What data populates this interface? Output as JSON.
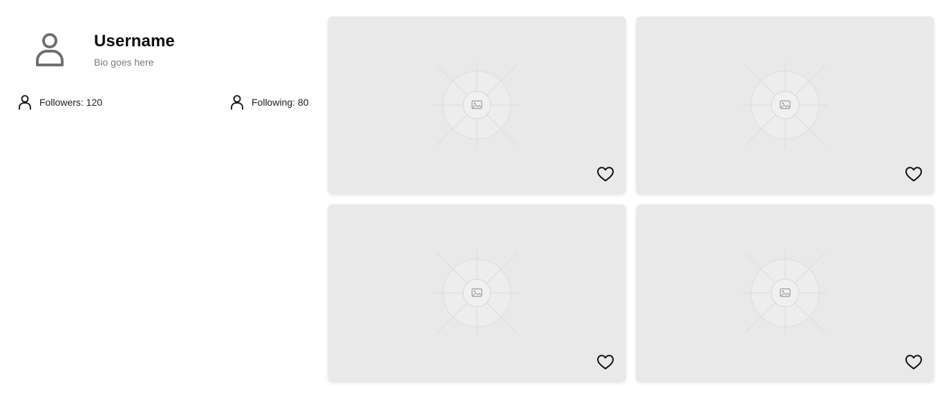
{
  "profile": {
    "avatar_icon": "user-icon",
    "username": "Username",
    "bio": "Bio goes here",
    "stats": {
      "followers": "Followers: 120",
      "following": "Following: 80"
    }
  },
  "grid": {
    "cards": [
      {
        "image_icon": "image-placeholder-icon",
        "action_icon": "heart-icon"
      },
      {
        "image_icon": "image-placeholder-icon",
        "action_icon": "heart-icon"
      },
      {
        "image_icon": "image-placeholder-icon",
        "action_icon": "heart-icon"
      },
      {
        "image_icon": "image-placeholder-icon",
        "action_icon": "heart-icon"
      }
    ]
  },
  "colors": {
    "card_background": "#e9e9e9",
    "avatar_gray": "#6f6f6f",
    "bio_text": "#7a7a7a"
  }
}
